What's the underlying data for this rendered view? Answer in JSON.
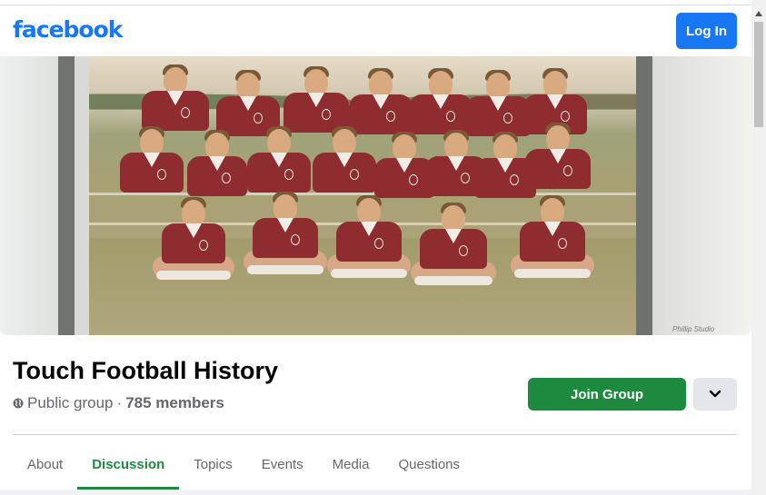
{
  "header": {
    "logo_text": "facebook",
    "login_label": "Log In"
  },
  "cover": {
    "signature_text": "Phillip Studio"
  },
  "group": {
    "name": "Touch Football History",
    "privacy": "Public group",
    "separator": "·",
    "members": "785 members",
    "join_label": "Join Group"
  },
  "tabs": [
    {
      "label": "About",
      "active": false
    },
    {
      "label": "Discussion",
      "active": true
    },
    {
      "label": "Topics",
      "active": false
    },
    {
      "label": "Events",
      "active": false
    },
    {
      "label": "Media",
      "active": false
    },
    {
      "label": "Questions",
      "active": false
    }
  ],
  "colors": {
    "brand": "#1877f2",
    "join": "#1e8a3f"
  },
  "icons": {
    "privacy": "globe-icon",
    "more": "chevron-down-icon"
  }
}
